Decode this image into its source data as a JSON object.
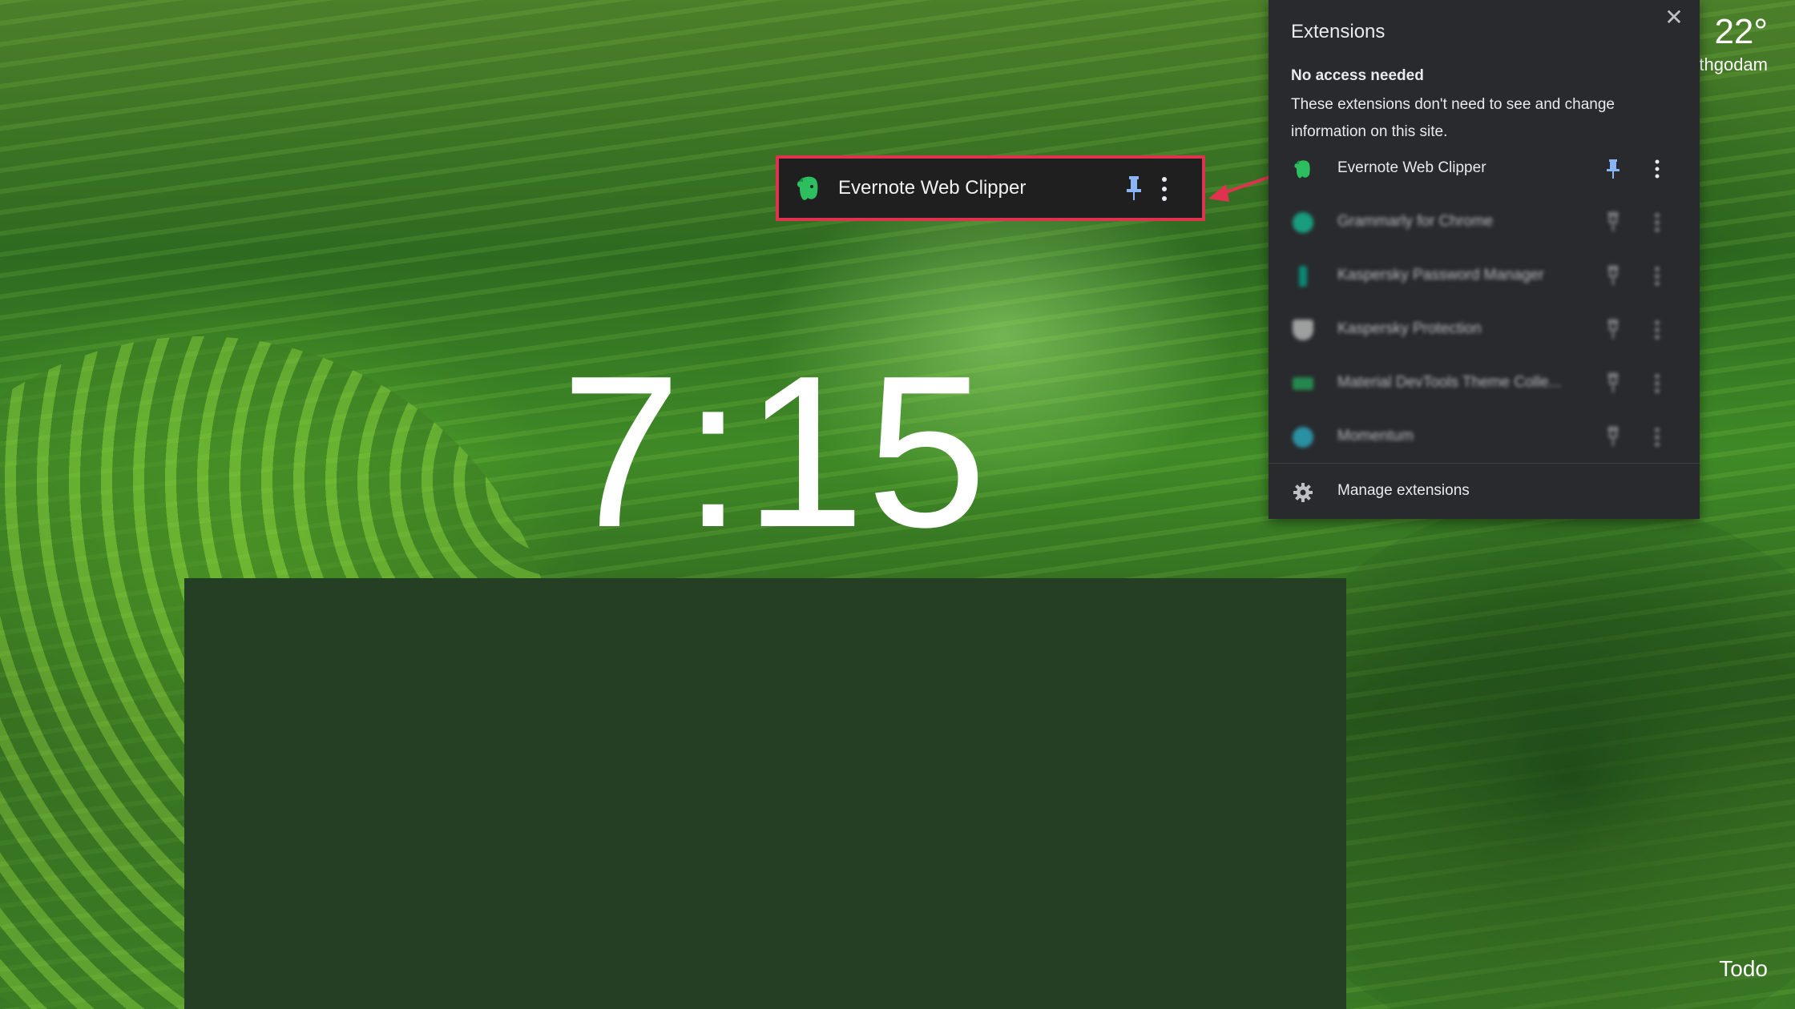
{
  "clock": {
    "time": "7:15"
  },
  "weather": {
    "temperature": "22°",
    "location": "thgodam"
  },
  "todo": {
    "label": "Todo"
  },
  "extensions_panel": {
    "title": "Extensions",
    "close_icon": "close-icon",
    "section_heading": "No access needed",
    "section_description": "These extensions don't need to see and change information on this site.",
    "items": [
      {
        "label": "Evernote Web Clipper",
        "icon": "evernote-icon",
        "pinned": true
      },
      {
        "label": "Grammarly for Chrome",
        "icon": "grammarly-icon",
        "pinned": false
      },
      {
        "label": "Kaspersky Password Manager",
        "icon": "kaspersky-password-icon",
        "pinned": false
      },
      {
        "label": "Kaspersky Protection",
        "icon": "kaspersky-protection-icon",
        "pinned": false
      },
      {
        "label": "Material DevTools Theme Colle...",
        "icon": "material-devtools-icon",
        "pinned": false
      },
      {
        "label": "Momentum",
        "icon": "momentum-icon",
        "pinned": false
      }
    ],
    "manage_label": "Manage extensions"
  },
  "callout": {
    "label": "Evernote Web Clipper",
    "border_color": "#e0324f"
  },
  "colors": {
    "panel_bg": "#292a2d",
    "pin_active": "#8ab4f8",
    "evernote_green": "#2dbe60",
    "dark_block": "#253f25"
  }
}
